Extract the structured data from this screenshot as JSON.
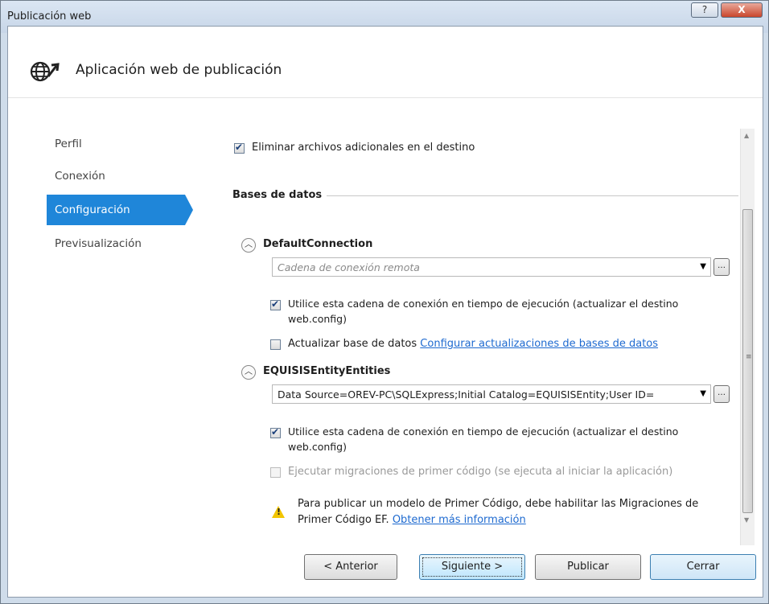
{
  "window": {
    "title": "Publicación web",
    "help_label": "?",
    "close_label": "X"
  },
  "header": {
    "title": "Aplicación web de publicación",
    "icon": "globe-publish-icon"
  },
  "nav": {
    "items": [
      {
        "label": "Perfil",
        "active": false
      },
      {
        "label": "Conexión",
        "active": false
      },
      {
        "label": "Configuración",
        "active": true
      },
      {
        "label": "Previsualización",
        "active": false
      }
    ]
  },
  "settings": {
    "delete_extra_files": {
      "label": "Eliminar archivos adicionales en el destino",
      "checked": true
    },
    "databases_heading": "Bases de datos",
    "connections": [
      {
        "name": "DefaultConnection",
        "connection_string": "",
        "connection_placeholder": "Cadena de conexión remota",
        "use_at_runtime": {
          "label_line1": "Utilice esta cadena de conexión en tiempo de ejecución (actualizar el destino",
          "label_line2": "web.config)",
          "checked": true
        },
        "update_db": {
          "label": "Actualizar base de datos",
          "checked": false
        },
        "configure_link": "Configurar actualizaciones de bases de datos"
      },
      {
        "name": "EQUISISEntityEntities",
        "connection_string": "Data Source=OREV-PC\\SQLExpress;Initial Catalog=EQUISISEntity;User ID=",
        "use_at_runtime": {
          "label_line1": "Utilice esta cadena de conexión en tiempo de ejecución (actualizar el destino",
          "label_line2": "web.config)",
          "checked": true
        },
        "migrations": {
          "label": "Ejecutar migraciones de primer código (se ejecuta al iniciar la aplicación)",
          "checked": false,
          "disabled": true
        },
        "warning_line1": "Para publicar un modelo de Primer Código, debe habilitar las Migraciones de",
        "warning_line2": "Primer Código EF.",
        "warning_link": "Obtener más información"
      }
    ]
  },
  "buttons": {
    "back": "< Anterior",
    "next": "Siguiente >",
    "publish": "Publicar",
    "close": "Cerrar"
  },
  "colors": {
    "accent": "#1f86d9",
    "link": "#1e6ad0",
    "warning": "#f2c500"
  }
}
